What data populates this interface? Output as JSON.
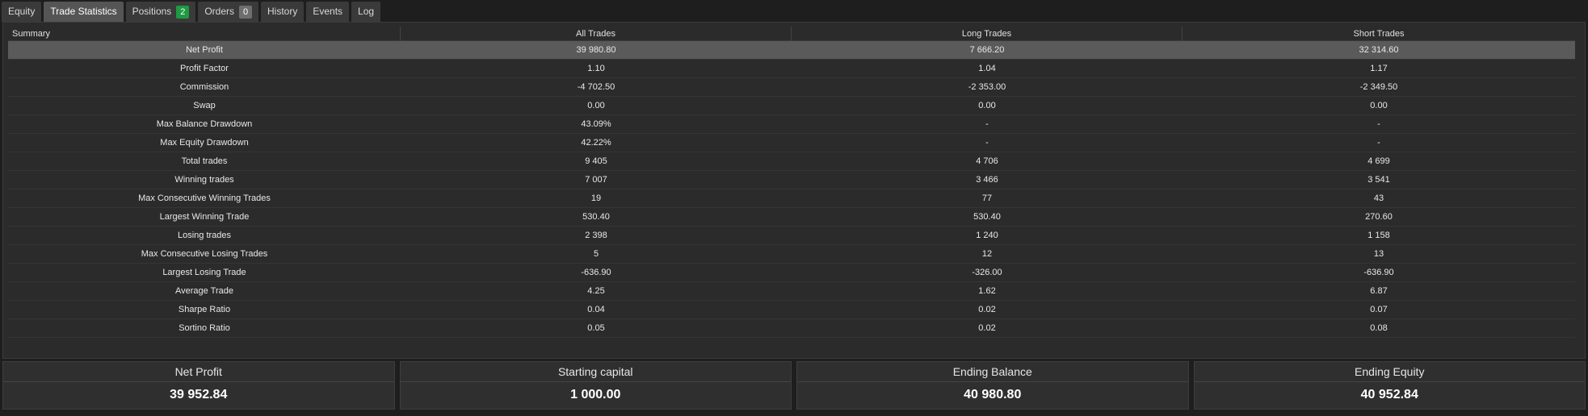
{
  "tabs": [
    {
      "label": "Equity",
      "active": false
    },
    {
      "label": "Trade Statistics",
      "active": true
    },
    {
      "label": "Positions",
      "active": false,
      "badge": "2",
      "badge_color": "#1e9a42"
    },
    {
      "label": "Orders",
      "active": false,
      "badge": "0",
      "badge_color": "#6e6e6e"
    },
    {
      "label": "History",
      "active": false
    },
    {
      "label": "Events",
      "active": false
    },
    {
      "label": "Log",
      "active": false
    }
  ],
  "table": {
    "headers": [
      "Summary",
      "All Trades",
      "Long Trades",
      "Short Trades"
    ],
    "selected_row": 0,
    "rows": [
      [
        "Net Profit",
        "39 980.80",
        "7 666.20",
        "32 314.60"
      ],
      [
        "Profit Factor",
        "1.10",
        "1.04",
        "1.17"
      ],
      [
        "Commission",
        "-4 702.50",
        "-2 353.00",
        "-2 349.50"
      ],
      [
        "Swap",
        "0.00",
        "0.00",
        "0.00"
      ],
      [
        "Max Balance Drawdown",
        "43.09%",
        "-",
        "-"
      ],
      [
        "Max Equity Drawdown",
        "42.22%",
        "-",
        "-"
      ],
      [
        "Total trades",
        "9 405",
        "4 706",
        "4 699"
      ],
      [
        "Winning trades",
        "7 007",
        "3 466",
        "3 541"
      ],
      [
        "Max Consecutive Winning Trades",
        "19",
        "77",
        "43"
      ],
      [
        "Largest Winning Trade",
        "530.40",
        "530.40",
        "270.60"
      ],
      [
        "Losing trades",
        "2 398",
        "1 240",
        "1 158"
      ],
      [
        "Max Consecutive Losing Trades",
        "5",
        "12",
        "13"
      ],
      [
        "Largest Losing Trade",
        "-636.90",
        "-326.00",
        "-636.90"
      ],
      [
        "Average Trade",
        "4.25",
        "1.62",
        "6.87"
      ],
      [
        "Sharpe Ratio",
        "0.04",
        "0.02",
        "0.07"
      ],
      [
        "Sortino Ratio",
        "0.05",
        "0.02",
        "0.08"
      ]
    ]
  },
  "cards": [
    {
      "label": "Net Profit",
      "value": "39 952.84"
    },
    {
      "label": "Starting capital",
      "value": "1 000.00"
    },
    {
      "label": "Ending Balance",
      "value": "40 980.80"
    },
    {
      "label": "Ending Equity",
      "value": "40 952.84"
    }
  ],
  "colors": {
    "background": "#1e1e1e",
    "panel": "#2b2b2b",
    "selected_row": "#5a5a5a",
    "active_tab": "#555555",
    "tab": "#3a3a3a"
  }
}
